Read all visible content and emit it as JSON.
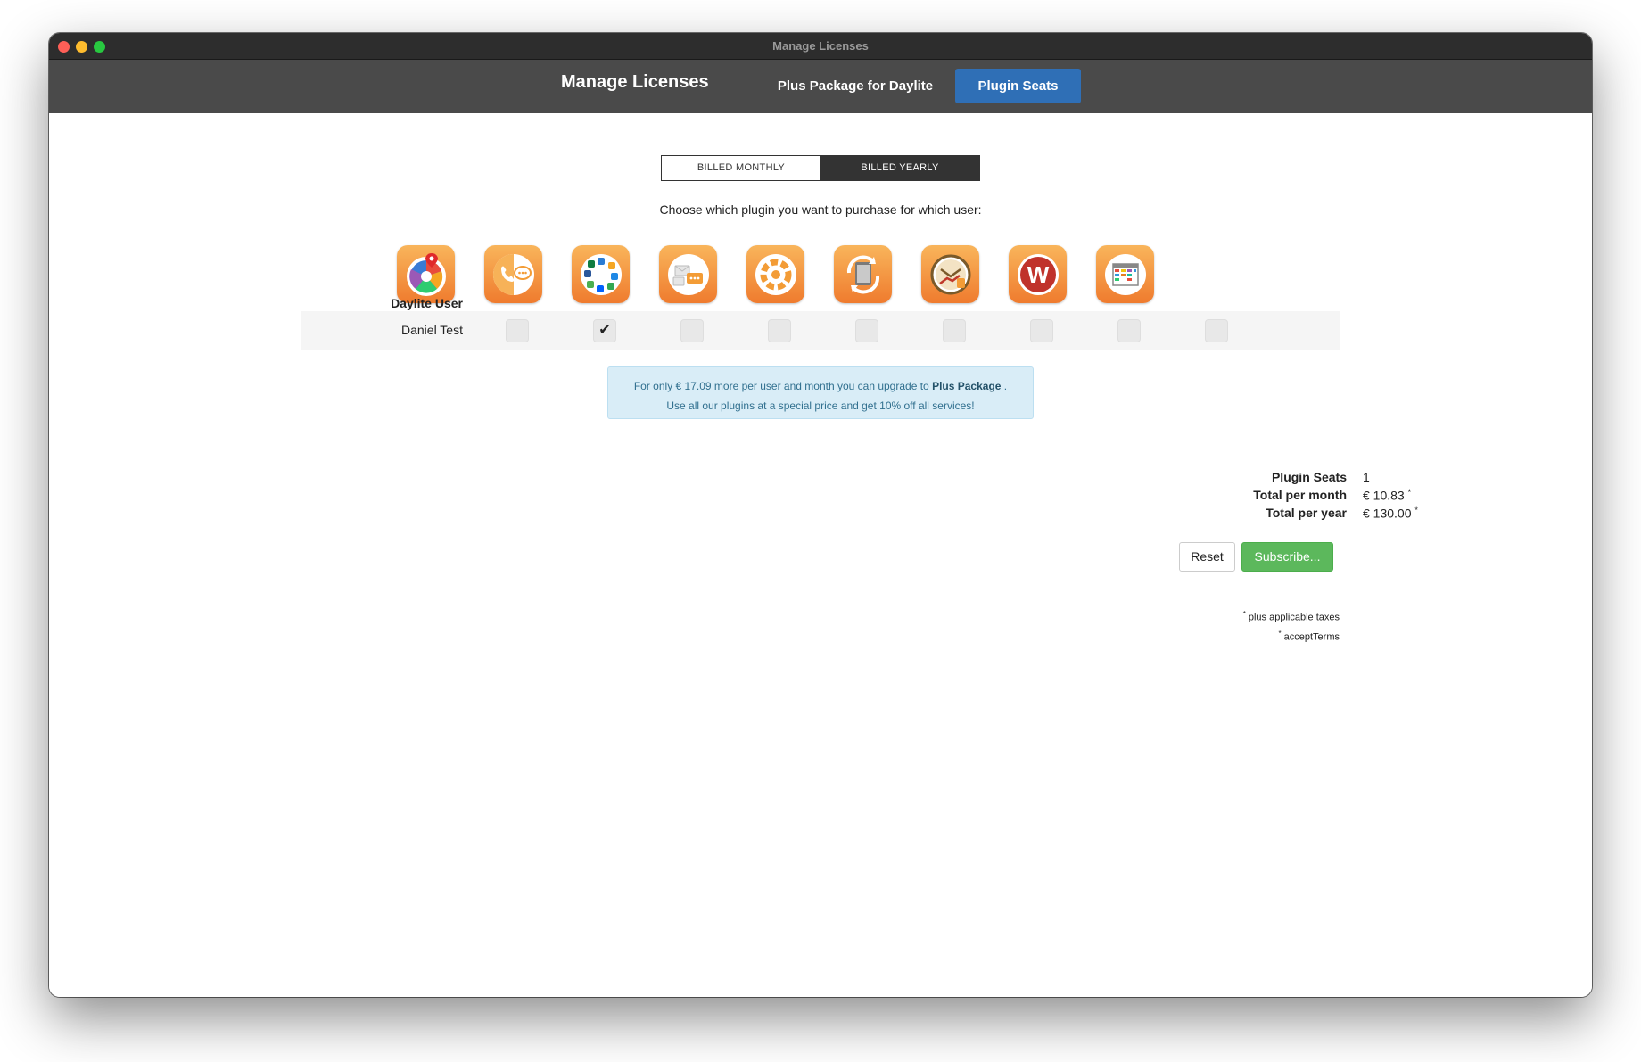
{
  "window": {
    "title": "Manage Licenses"
  },
  "navbar": {
    "brand": "Manage Licenses",
    "tabs": [
      {
        "label": "Plus Package for Daylite",
        "active": false
      },
      {
        "label": "Plugin Seats",
        "active": true
      }
    ],
    "active_color": "#2f6fb6"
  },
  "billing": {
    "monthly_label": "BILLED MONTHLY",
    "yearly_label": "BILLED YEARLY",
    "selected": "yearly"
  },
  "instructions": "Choose which plugin you want to purchase for which user:",
  "plugins": [
    {
      "icon": "social-network-map-icon"
    },
    {
      "icon": "phone-chat-icon"
    },
    {
      "icon": "app-integrations-icon"
    },
    {
      "icon": "email-messages-icon"
    },
    {
      "icon": "gear-workflow-icon"
    },
    {
      "icon": "sync-document-icon"
    },
    {
      "icon": "time-tracking-clock-icon"
    },
    {
      "icon": "wrike-w-icon"
    },
    {
      "icon": "kanban-board-icon"
    }
  ],
  "table": {
    "user_column_header": "Daylite User",
    "rows": [
      {
        "name": "Daniel Test",
        "checked": [
          false,
          true,
          false,
          false,
          false,
          false,
          false,
          false,
          false
        ]
      }
    ],
    "check_glyph": "✔"
  },
  "upgrade_notice": {
    "line1_prefix": "For only € 17.09 more per user and month you can upgrade to",
    "package_name": "Plus Package",
    "line1_suffix": ".",
    "line2": "Use all our plugins at a special price and get 10% off all services!"
  },
  "summary": {
    "seats_label": "Plugin Seats",
    "seats_value": "1",
    "month_label": "Total per month",
    "month_value": "€ 10.83",
    "year_label": "Total per year",
    "year_value": "€ 130.00",
    "asterisk": "*"
  },
  "buttons": {
    "reset": "Reset",
    "subscribe": "Subscribe..."
  },
  "footnotes": {
    "taxes": "plus applicable taxes",
    "terms": "acceptTerms"
  }
}
